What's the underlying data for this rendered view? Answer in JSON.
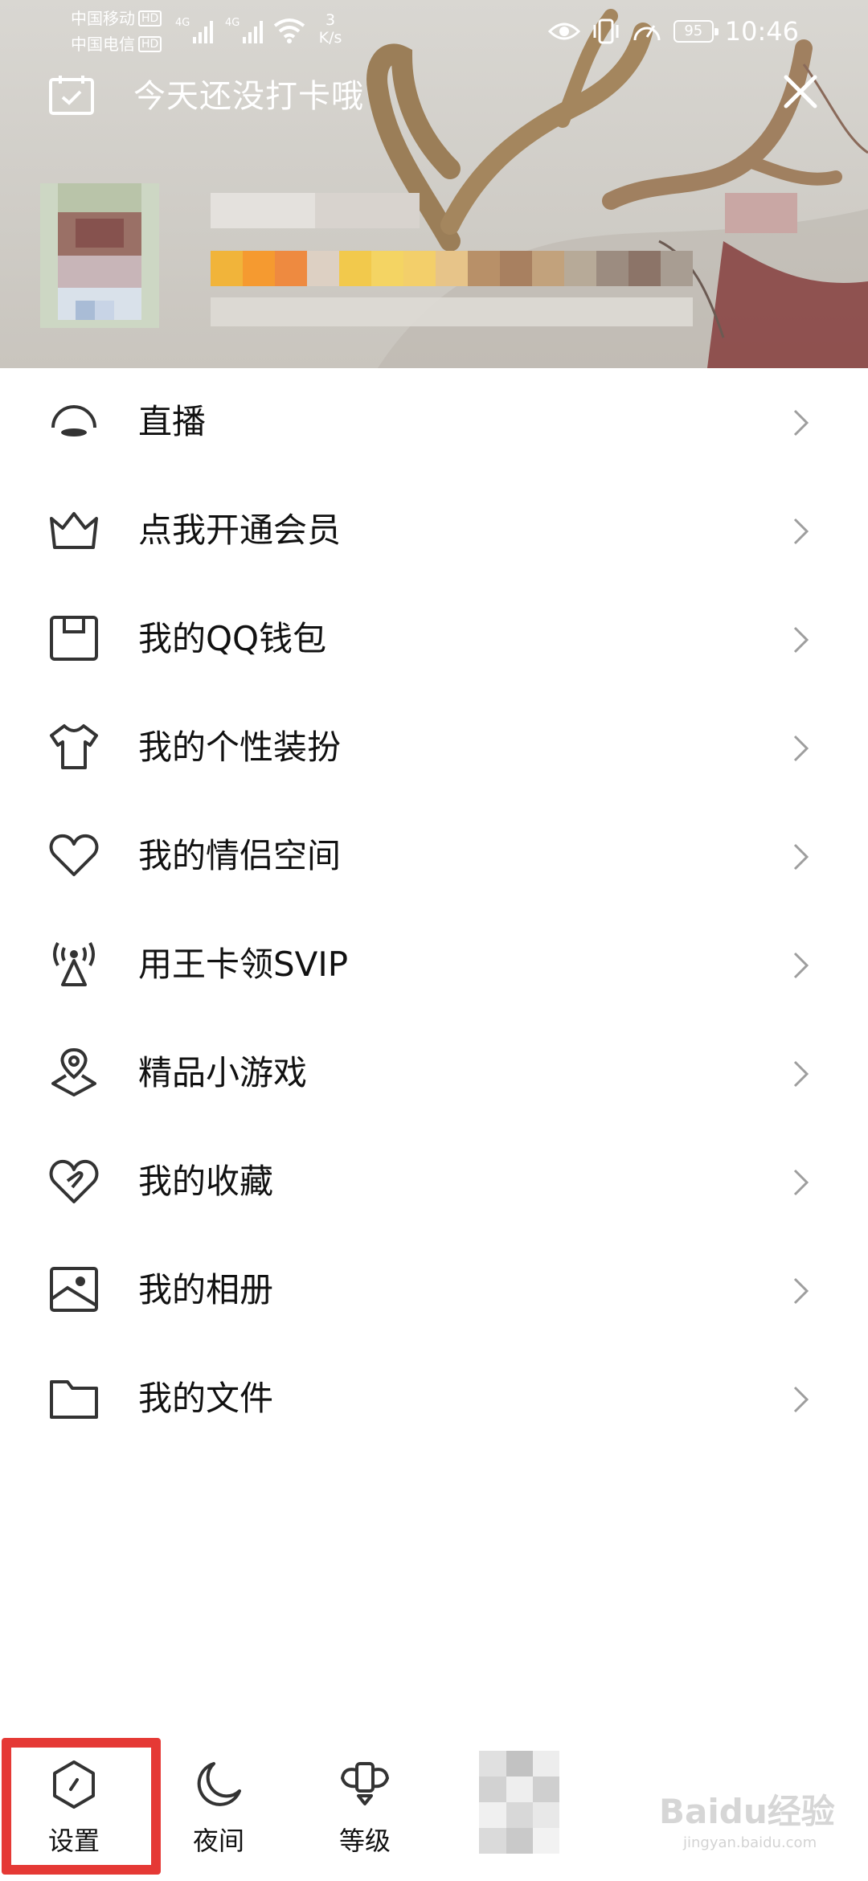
{
  "status_bar": {
    "carrier1": "中国移动",
    "carrier2": "中国电信",
    "hd": "HD",
    "network1": "4G",
    "network2": "4G",
    "speed_value": "3",
    "speed_unit": "K/s",
    "battery": "95",
    "time": "10:46"
  },
  "header": {
    "checkin_text": "今天还没打卡哦"
  },
  "menu": {
    "items": [
      {
        "label": "直播",
        "icon": "live-icon"
      },
      {
        "label": "点我开通会员",
        "icon": "crown-icon"
      },
      {
        "label": "我的QQ钱包",
        "icon": "wallet-icon"
      },
      {
        "label": "我的个性装扮",
        "icon": "tshirt-icon"
      },
      {
        "label": "我的情侣空间",
        "icon": "heart-icon"
      },
      {
        "label": "用王卡领SVIP",
        "icon": "signal-tower-icon"
      },
      {
        "label": "精品小游戏",
        "icon": "game-pin-icon"
      },
      {
        "label": "我的收藏",
        "icon": "favorite-icon"
      },
      {
        "label": "我的相册",
        "icon": "album-icon"
      },
      {
        "label": "我的文件",
        "icon": "folder-icon"
      }
    ]
  },
  "bottom_bar": {
    "settings": "设置",
    "night": "夜间",
    "level": "等级"
  },
  "watermark": {
    "brand": "Baidu经验",
    "url": "jingyan.baidu.com"
  },
  "colors": {
    "highlight": "#e53935",
    "icon": "#333333"
  }
}
